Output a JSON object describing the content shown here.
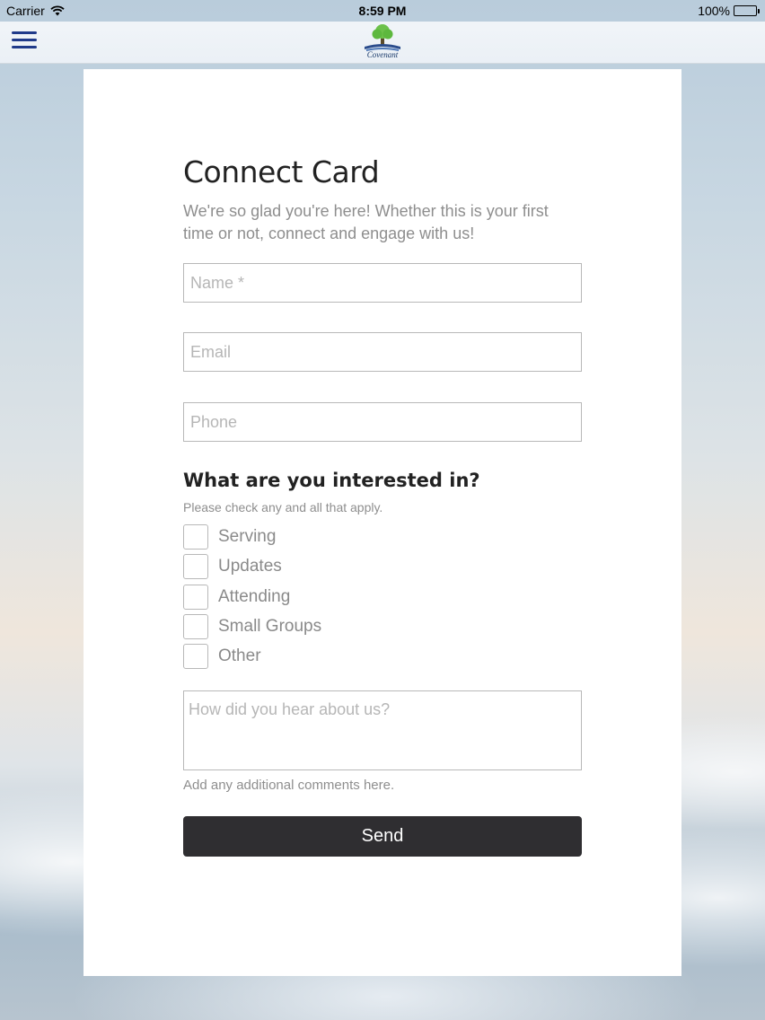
{
  "status_bar": {
    "carrier": "Carrier",
    "time": "8:59 PM",
    "battery": "100%"
  },
  "nav": {
    "menu_icon": "hamburger-menu-icon",
    "logo_text": "Covenant",
    "accent_color": "#1f3a8a"
  },
  "form": {
    "title": "Connect Card",
    "subtitle": "We're so glad you're here! Whether this is your first time or not, connect and engage with us!",
    "name_placeholder": "Name *",
    "email_placeholder": "Email",
    "phone_placeholder": "Phone",
    "interests_heading": "What are you interested in?",
    "interests_help": "Please check any and all that apply.",
    "interests": [
      {
        "label": "Serving",
        "checked": false
      },
      {
        "label": "Updates",
        "checked": false
      },
      {
        "label": "Attending",
        "checked": false
      },
      {
        "label": "Small Groups",
        "checked": false
      },
      {
        "label": "Other",
        "checked": false
      }
    ],
    "comments_placeholder": "How did you hear about us?",
    "comments_help": "Add any additional comments here.",
    "send_label": "Send"
  }
}
